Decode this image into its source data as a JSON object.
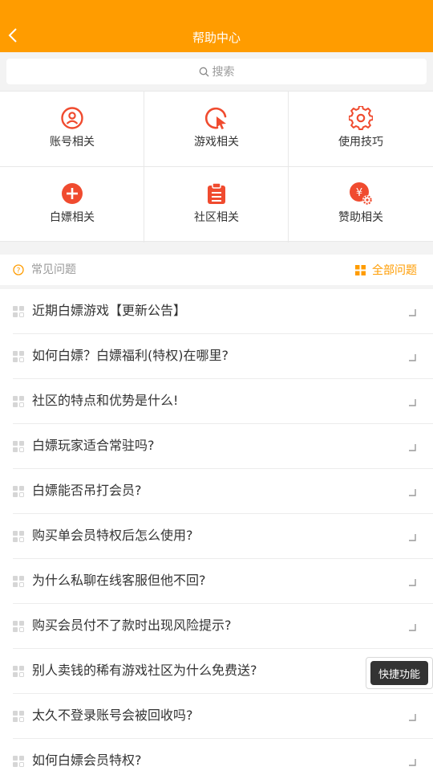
{
  "header": {
    "title": "帮助中心",
    "back_icon": "chevron-left-icon"
  },
  "search": {
    "placeholder": "搜索",
    "icon": "search-icon"
  },
  "categories": [
    {
      "label": "账号相关",
      "icon": "user-circle-icon"
    },
    {
      "label": "游戏相关",
      "icon": "cursor-click-icon"
    },
    {
      "label": "使用技巧",
      "icon": "gear-icon"
    },
    {
      "label": "白嫖相关",
      "icon": "plus-circle-icon"
    },
    {
      "label": "社区相关",
      "icon": "clipboard-icon"
    },
    {
      "label": "赞助相关",
      "icon": "yen-gear-icon"
    }
  ],
  "faq": {
    "title": "常见问题",
    "all_label": "全部问题",
    "items": [
      "近期白嫖游戏【更新公告】",
      "如何白嫖？白嫖福利(特权)在哪里?",
      "社区的特点和优势是什么!",
      "白嫖玩家适合常驻吗?",
      "白嫖能否吊打会员?",
      "购买单会员特权后怎么使用?",
      "为什么私聊在线客服但他不回?",
      "购买会员付不了款时出现风险提示?",
      "别人卖钱的稀有游戏社区为什么免费送?",
      "太久不登录账号会被回收吗?",
      "如何白嫖会员特权?"
    ]
  },
  "quick_action": {
    "label": "快捷功能"
  },
  "colors": {
    "accent": "#ff9c00",
    "icon_red": "#f04b2f"
  }
}
